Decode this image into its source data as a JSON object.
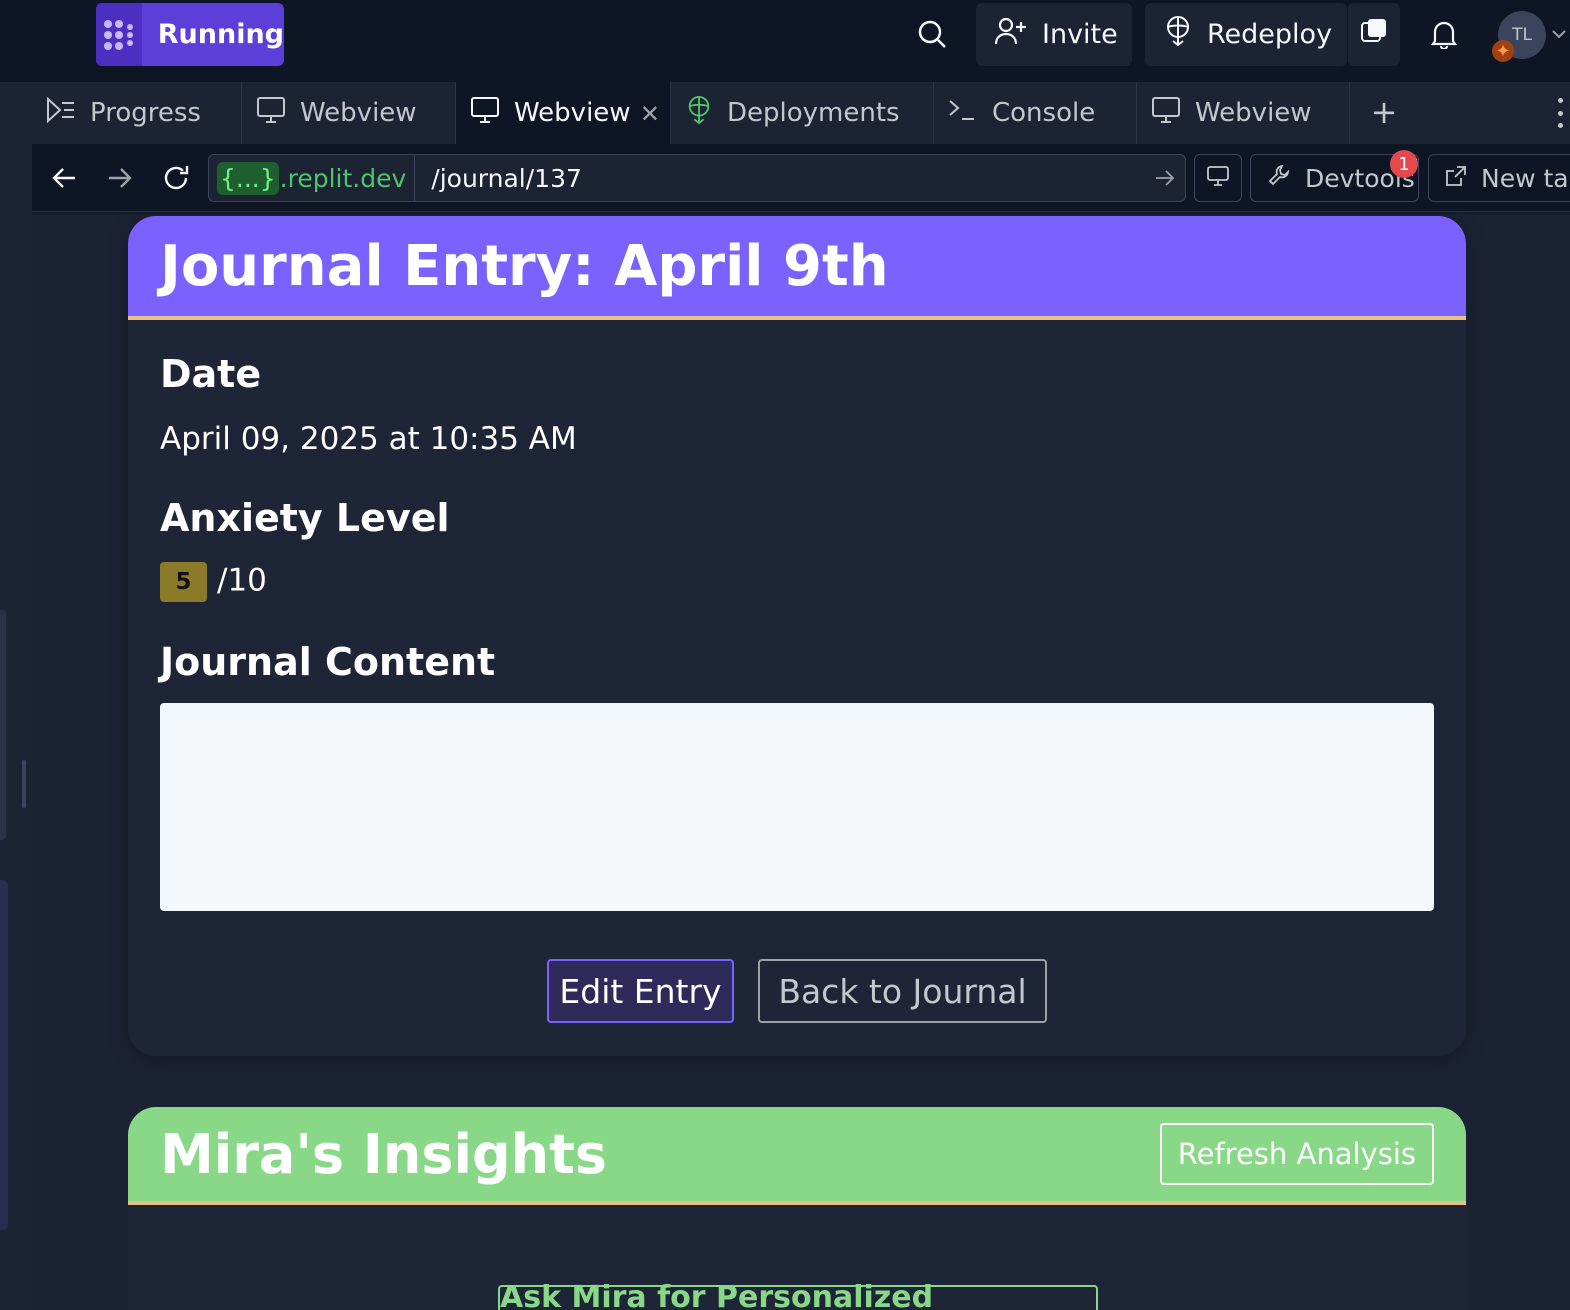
{
  "topbar": {
    "run_label": "Running",
    "invite_label": "Invite",
    "redeploy_label": "Redeploy",
    "avatar_initials": "TL"
  },
  "tabs": [
    {
      "label": "Progress",
      "icon": "progress-icon"
    },
    {
      "label": "Webview",
      "icon": "monitor-icon"
    },
    {
      "label": "Webview",
      "icon": "monitor-icon",
      "active": true
    },
    {
      "label": "Deployments",
      "icon": "deploy-icon"
    },
    {
      "label": "Console",
      "icon": "terminal-icon"
    },
    {
      "label": "Webview",
      "icon": "monitor-icon"
    }
  ],
  "urlbar": {
    "host_braces": "{...}",
    "host_suffix": ".replit.dev",
    "path": "/journal/137",
    "devtools_label": "Devtools",
    "devtools_badge": "1",
    "newtab_label": "New tab"
  },
  "entry": {
    "title": "Journal Entry: April 9th",
    "date_label": "Date",
    "date_value": "April 09, 2025 at 10:35 AM",
    "anxiety_label": "Anxiety Level",
    "anxiety_value": "5",
    "anxiety_max": "/10",
    "content_label": "Journal Content",
    "edit_label": "Edit Entry",
    "back_label": "Back to Journal"
  },
  "insights": {
    "title": "Mira's Insights",
    "refresh_label": "Refresh Analysis",
    "ask_label": "Ask Mira for Personalized Guidance"
  },
  "colors": {
    "accent": "#7b61ff",
    "insights": "#88d888",
    "badge": "#8a7a2a",
    "bg": "#0e1525"
  }
}
